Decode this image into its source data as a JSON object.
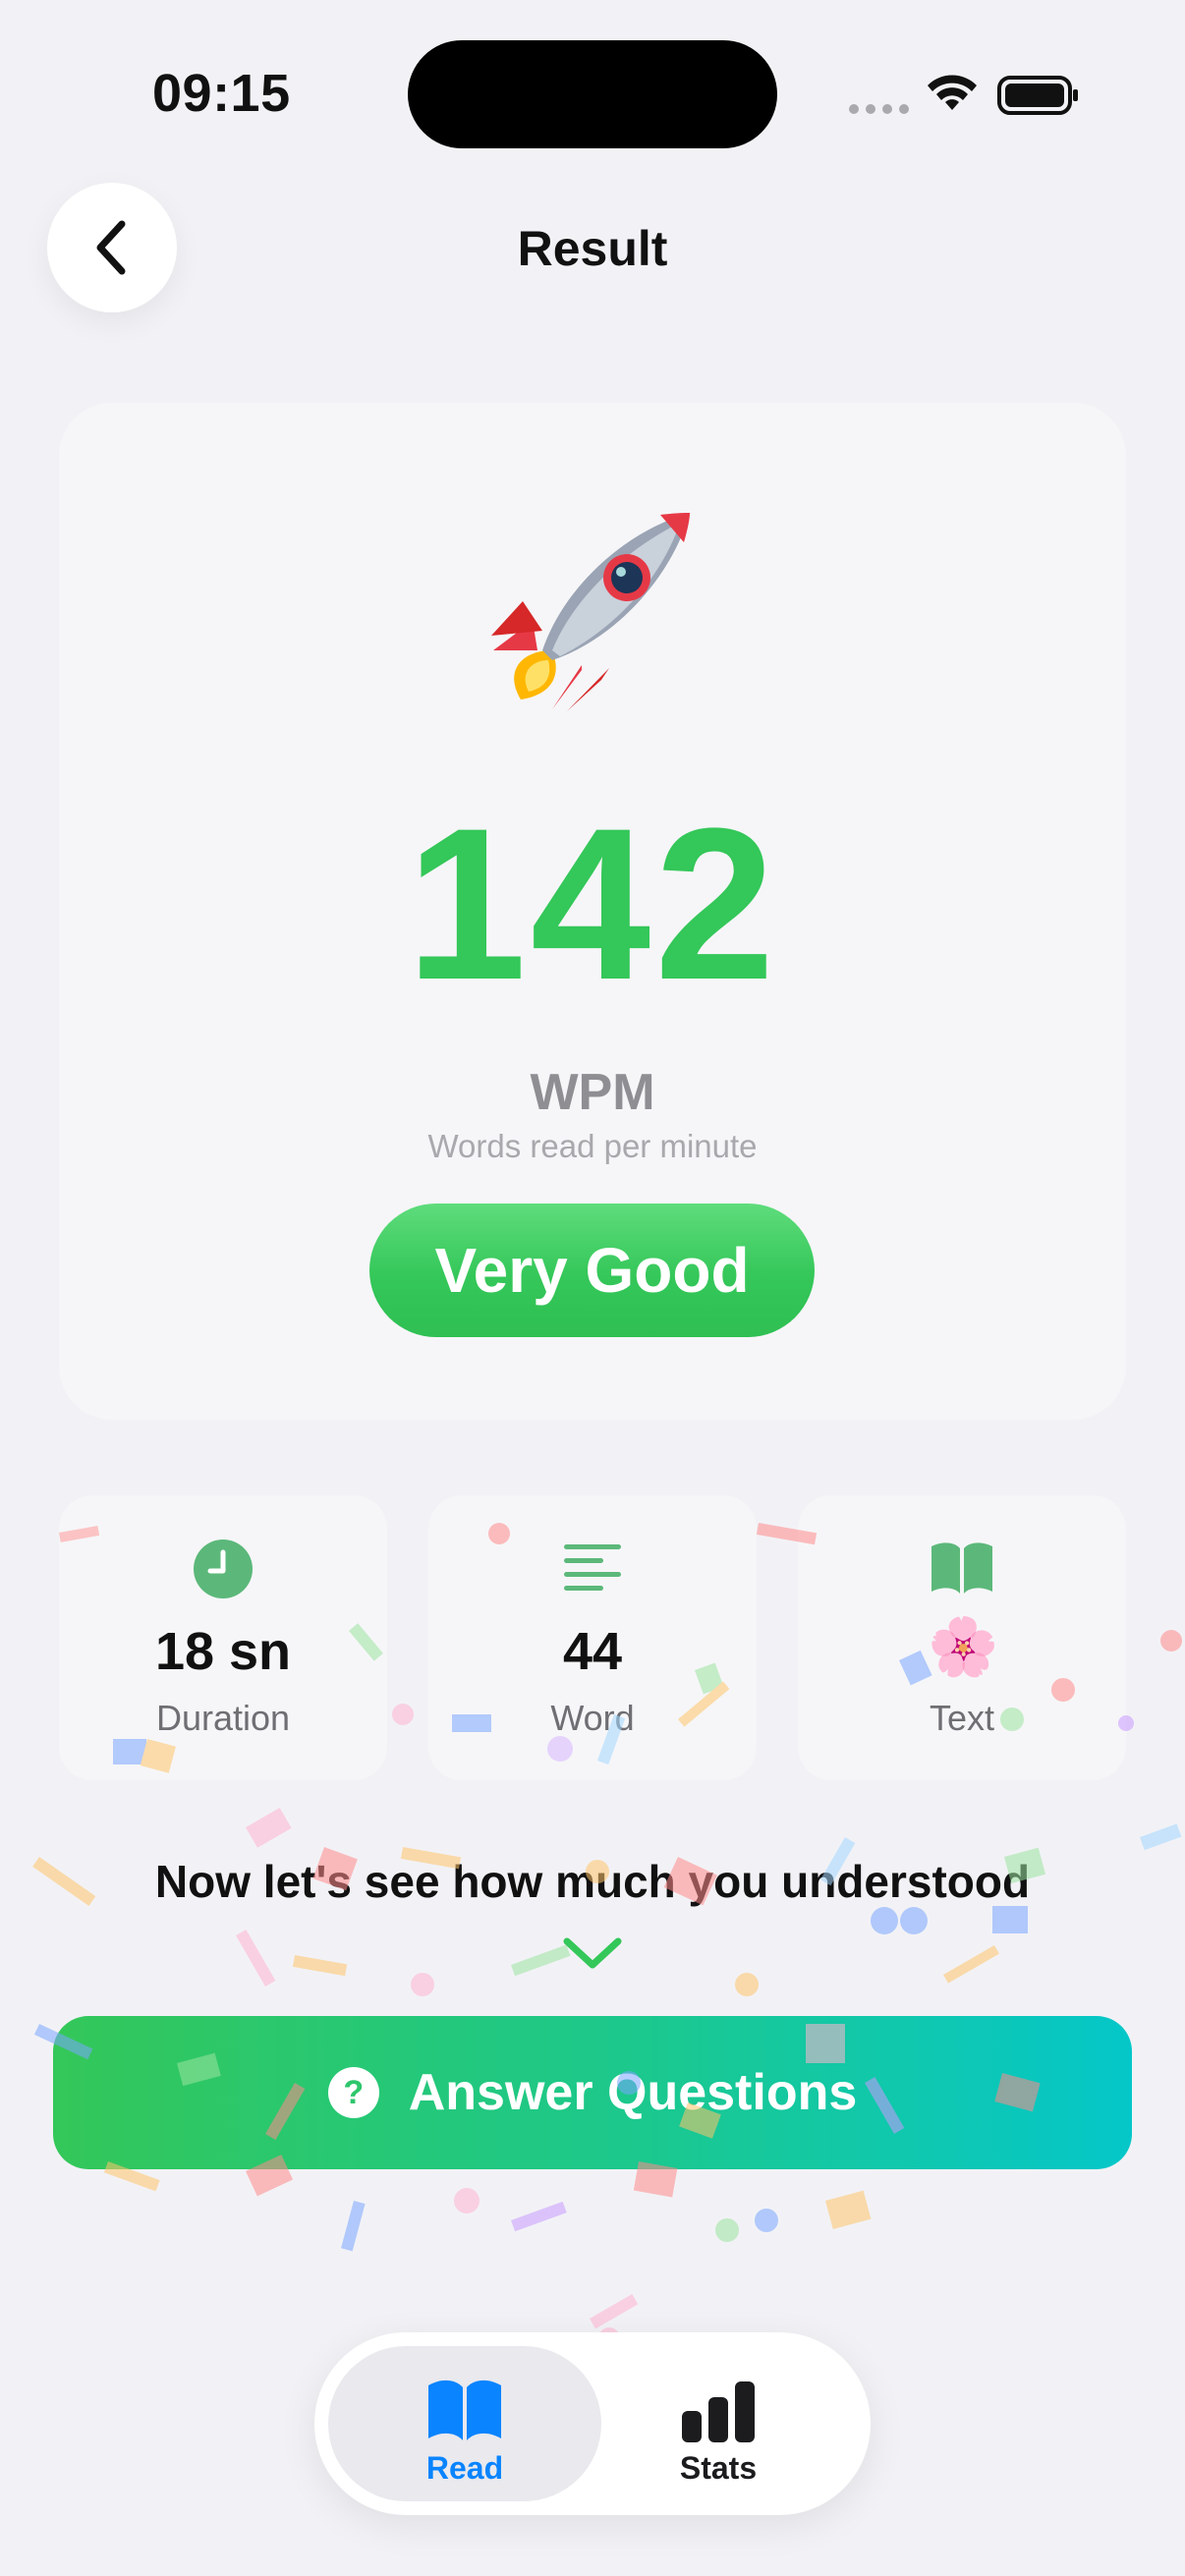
{
  "status_bar": {
    "time": "09:15"
  },
  "header": {
    "title": "Result"
  },
  "result": {
    "wpm": "142",
    "unit": "WPM",
    "unit_caption": "Words read per minute",
    "rating": "Very Good"
  },
  "stats": [
    {
      "icon": "clock-icon",
      "value": "18 sn",
      "label": "Duration"
    },
    {
      "icon": "lines-icon",
      "value": "44",
      "label": "Word"
    },
    {
      "icon": "book-icon",
      "value": "🌸",
      "label": "Text"
    }
  ],
  "prompt": {
    "text": "Now let's see how much you understood"
  },
  "cta": {
    "label": "Answer Questions"
  },
  "tab_bar": {
    "items": [
      {
        "label": "Read",
        "active": true
      },
      {
        "label": "Stats",
        "active": false
      }
    ]
  },
  "colors": {
    "accent_green": "#34c759",
    "active_blue": "#0a84ff",
    "cta_gradient_start": "#34c759",
    "cta_gradient_end": "#05c7c9"
  }
}
